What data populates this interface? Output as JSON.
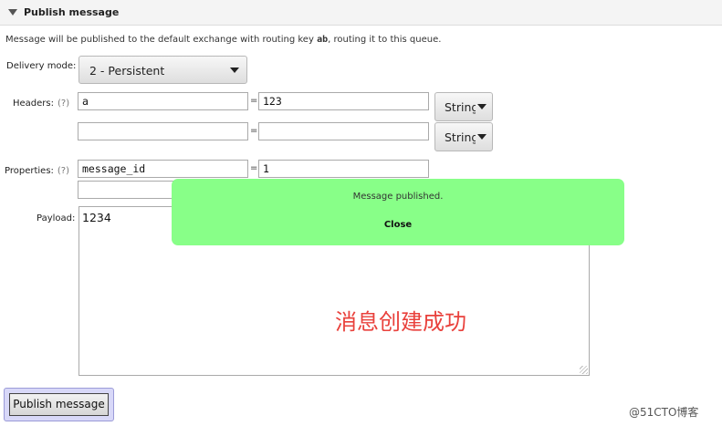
{
  "section": {
    "title": "Publish message"
  },
  "description": {
    "before": "Message will be published to the default exchange with routing key ",
    "routing_key": "ab",
    "after": ", routing it to this queue."
  },
  "delivery_mode": {
    "label": "Delivery mode:",
    "value": "2 - Persistent"
  },
  "headers": {
    "label": "Headers:",
    "help": "(?)",
    "rows": [
      {
        "key": "a",
        "value": "123",
        "type": "String"
      },
      {
        "key": "",
        "value": "",
        "type": "String"
      }
    ]
  },
  "properties": {
    "label": "Properties:",
    "help": "(?)",
    "rows": [
      {
        "key": "message_id",
        "value": "1"
      },
      {
        "key": "",
        "value": ""
      }
    ]
  },
  "equals": "=",
  "payload": {
    "label": "Payload:",
    "value": "1234"
  },
  "toast": {
    "message": "Message published.",
    "close_label": "Close",
    "color": "#88ff88"
  },
  "annotation": "消息创建成功",
  "publish_button": {
    "label": "Publish message"
  },
  "watermark": "@51CTO博客"
}
